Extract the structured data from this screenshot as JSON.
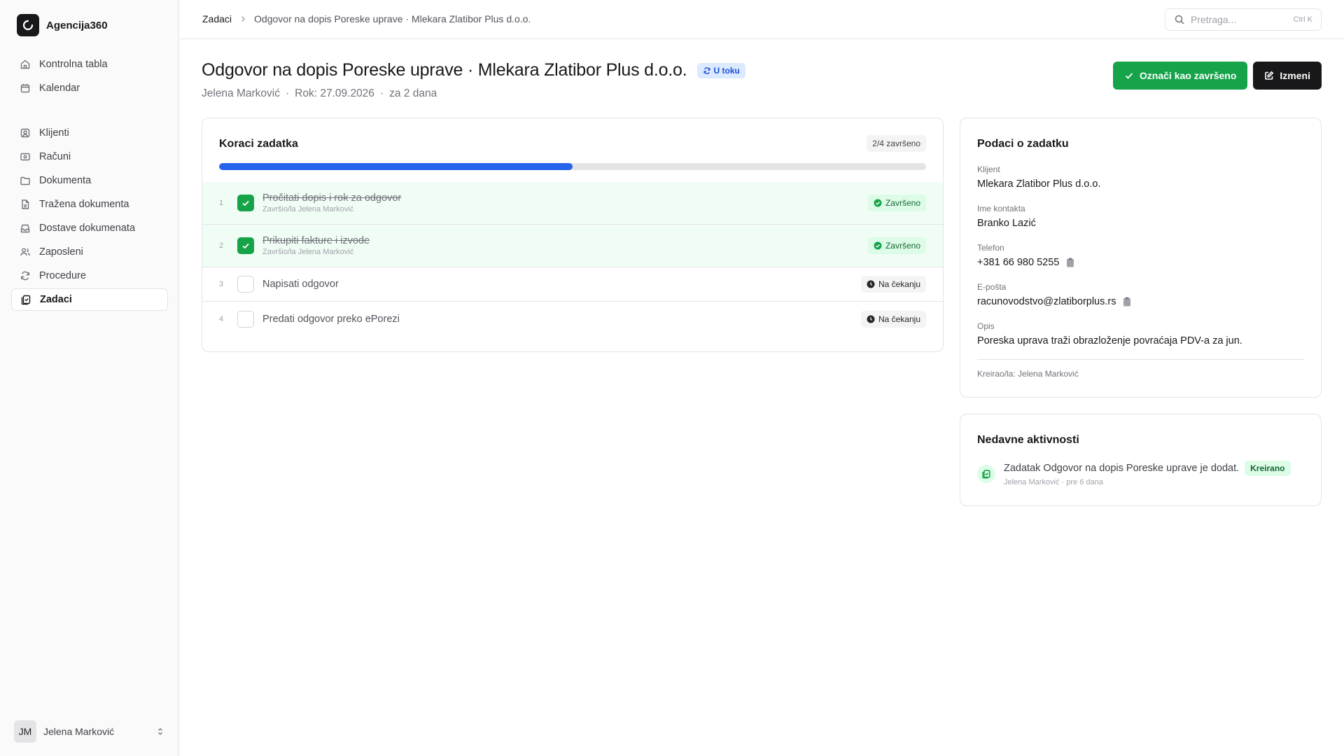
{
  "app": {
    "name": "Agencija360"
  },
  "sidebar": {
    "nav_top": [
      {
        "label": "Kontrolna tabla",
        "icon": "home-icon"
      },
      {
        "label": "Kalendar",
        "icon": "calendar-icon"
      }
    ],
    "nav_main": [
      {
        "label": "Klijenti",
        "icon": "users-icon"
      },
      {
        "label": "Računi",
        "icon": "receipt-icon"
      },
      {
        "label": "Dokumenta",
        "icon": "folder-icon"
      },
      {
        "label": "Tražena dokumenta",
        "icon": "file-icon"
      },
      {
        "label": "Dostave dokumenata",
        "icon": "inbox-icon"
      },
      {
        "label": "Zaposleni",
        "icon": "team-icon"
      },
      {
        "label": "Procedure",
        "icon": "refresh-icon"
      },
      {
        "label": "Zadaci",
        "icon": "tasks-icon",
        "active": true
      }
    ],
    "user": {
      "initials": "JM",
      "name": "Jelena Marković"
    }
  },
  "breadcrumb": {
    "parent": "Zadaci",
    "current": "Odgovor na dopis Poreske uprave · Mlekara Zlatibor Plus d.o.o."
  },
  "search": {
    "placeholder": "Pretraga...",
    "shortcut": "Ctrl K"
  },
  "task": {
    "title": "Odgovor na dopis Poreske uprave · Mlekara Zlatibor Plus d.o.o.",
    "status": "U toku",
    "assignee": "Jelena Marković",
    "due": "Rok: 27.09.2026",
    "relative_due": "za 2 dana",
    "sep": "·"
  },
  "actions": {
    "complete_label": "Označi kao završeno",
    "edit_label": "Izmeni"
  },
  "steps_card": {
    "title": "Koraci zadatka",
    "count": "2/4 završeno",
    "progress": 0.5,
    "steps": [
      {
        "num": "1",
        "label": "Pročitati dopis i rok za odgovor",
        "sub": "Završio/la Jelena Marković",
        "status": "Završeno",
        "done": true
      },
      {
        "num": "2",
        "label": "Prikupiti fakture i izvode",
        "sub": "Završio/la Jelena Marković",
        "status": "Završeno",
        "done": true
      },
      {
        "num": "3",
        "label": "Napisati odgovor",
        "sub": "",
        "status": "Na čekanju",
        "done": false
      },
      {
        "num": "4",
        "label": "Predati odgovor preko ePorezi",
        "sub": "",
        "status": "Na čekanju",
        "done": false
      }
    ]
  },
  "details": {
    "title": "Podaci o zadatku",
    "client_label": "Klijent",
    "client": "Mlekara Zlatibor Plus d.o.o.",
    "contact_label": "Ime kontakta",
    "contact": "Branko Lazić",
    "phone_label": "Telefon",
    "phone": "+381 66 980 5255",
    "email_label": "E-pošta",
    "email": "racunovodstvo@zlatiborplus.rs",
    "description_label": "Opis",
    "description": "Poreska uprava traži obrazloženje povraćaja PDV-a za jun.",
    "created_by": "Kreirao/la: Jelena Marković"
  },
  "activity": {
    "title": "Nedavne aktivnosti",
    "items": [
      {
        "text": "Zadatak Odgovor na dopis Poreske uprave je dodat.",
        "badge": "Kreirano",
        "meta": "Jelena Marković · pre 6 dana"
      }
    ]
  },
  "colors": {
    "success": "#16a34a",
    "primary": "#2563eb",
    "dark": "#18181b"
  }
}
